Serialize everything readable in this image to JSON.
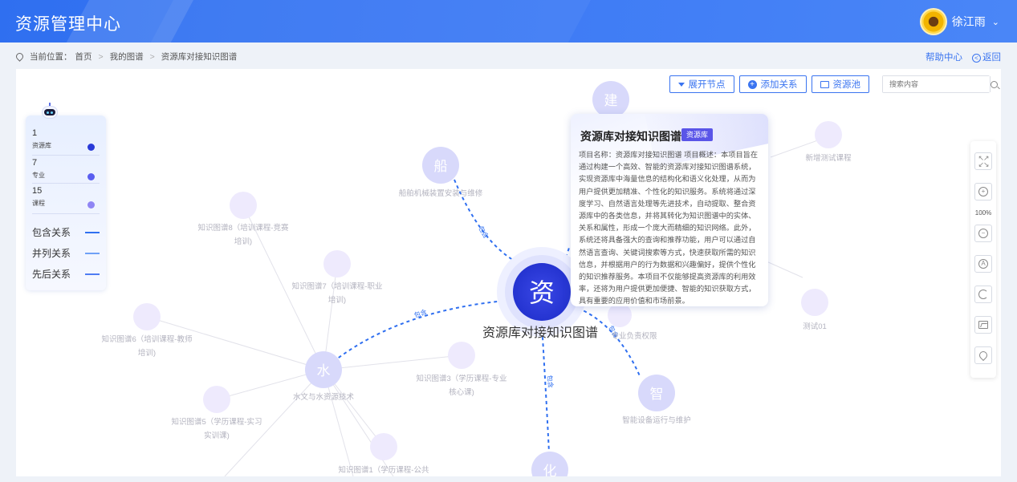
{
  "app": {
    "title": "资源管理中心"
  },
  "user": {
    "name": "徐江雨"
  },
  "breadcrumb": {
    "prefix": "当前位置：",
    "items": [
      "首页",
      "我的图谱",
      "资源库对接知识图谱"
    ]
  },
  "top_links": {
    "help": "帮助中心",
    "back": "返回"
  },
  "toolbar": {
    "expand": "展开节点",
    "add_relation": "添加关系",
    "resource_pool": "资源池",
    "search_placeholder": "搜索内容"
  },
  "legend": {
    "categories": [
      {
        "count": "1",
        "name": "资源库",
        "color": "#2a3ad8"
      },
      {
        "count": "7",
        "name": "专业",
        "color": "#5a5ef0"
      },
      {
        "count": "15",
        "name": "课程",
        "color": "#8f85f4"
      }
    ],
    "relations": [
      {
        "name": "包含关系",
        "color": "#2f6ff0"
      },
      {
        "name": "并列关系",
        "color": "#6fa0f7"
      },
      {
        "name": "先后关系",
        "color": "#4f7cf3"
      }
    ]
  },
  "graph": {
    "center": {
      "char": "资",
      "label": "资源库对接知识图谱"
    },
    "majors": [
      {
        "char": "船",
        "label": "船舶机械装置安装与维修"
      },
      {
        "char": "水",
        "label": "水文与水资源技术"
      },
      {
        "char": "智",
        "label": "智能设备运行与维护"
      },
      {
        "char": "化",
        "label": ""
      },
      {
        "char": "建",
        "label": ""
      }
    ],
    "courses": [
      {
        "label_lines": [
          "知识图谱8（培训课程-竞赛",
          "培训)"
        ]
      },
      {
        "label_lines": [
          "知识图谱7（培训课程-职业",
          "培训)"
        ]
      },
      {
        "label_lines": [
          "知识图谱6（培训课程-教师",
          "培训)"
        ]
      },
      {
        "label_lines": [
          "知识图谱5（学历课程-实习",
          "实训课)"
        ]
      },
      {
        "label_lines": [
          "知识图谱3（学历课程-专业",
          "核心课)"
        ]
      },
      {
        "label_lines": [
          "知识图谱1（学历课程-公共"
        ]
      },
      {
        "label_lines": [
          "新增测试课程"
        ]
      },
      {
        "label_lines": [
          "测试01"
        ]
      },
      {
        "label_lines": [
          "专业负责权限"
        ]
      }
    ],
    "relation_label": "包含"
  },
  "card": {
    "title": "资源库对接知识图谱",
    "badge": "资源库",
    "lines": [
      "项目名称：资源库对接知识图谱 项目概述：本项目旨在",
      "通过构建一个高效、智能的资源库对接知识图谱系统，",
      "实现资源库中海量信息的结构化和语义化处理，从而为",
      "用户提供更加精准、个性化的知识服务。系统将通过深",
      "度学习、自然语言处理等先进技术，自动提取、整合资",
      "源库中的各类信息，并将其转化为知识图谱中的实体、",
      "关系和属性，形成一个庞大而精细的知识网络。此外，",
      "系统还将具备强大的查询和推荐功能，用户可以通过自",
      "然语言查询、关键词搜索等方式，快速获取所需的知识",
      "信息，并根据用户的行为数据和兴趣偏好，提供个性化",
      "的知识推荐服务。本项目不仅能够提高资源库的利用效",
      "率，还将为用户提供更加便捷、智能的知识获取方式，",
      "具有重要的应用价值和市场前景。"
    ]
  },
  "zoom": {
    "level": "100%"
  }
}
